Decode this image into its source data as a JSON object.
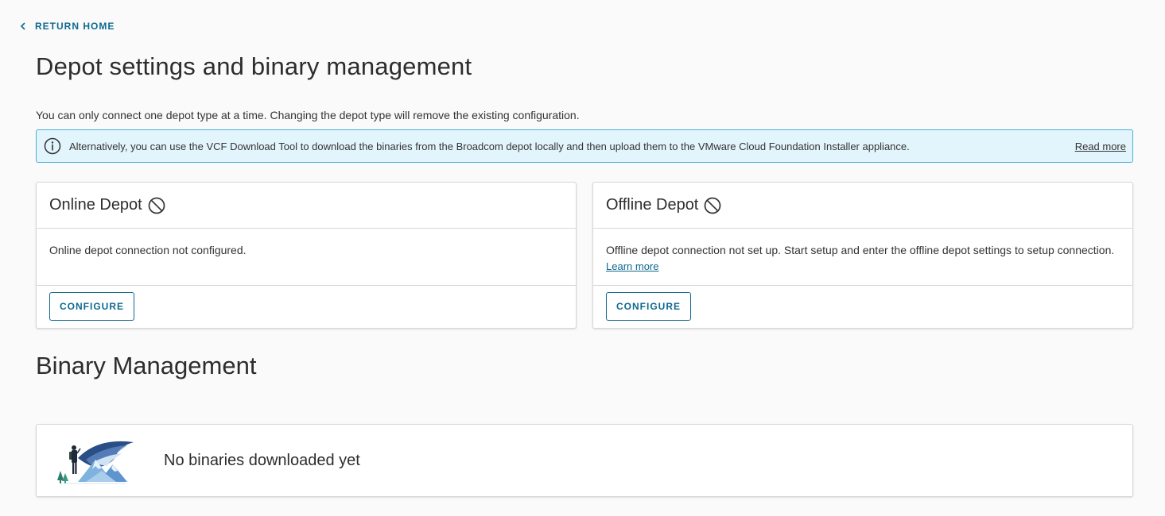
{
  "nav": {
    "return_home": "RETURN HOME"
  },
  "page": {
    "title": "Depot settings and binary management",
    "intro": "You can only connect one depot type at a time. Changing the depot type will remove the existing configuration."
  },
  "alert": {
    "icon": "info-icon",
    "text": "Alternatively, you can use the VCF Download Tool to download the binaries from the Broadcom depot locally and then upload them to the VMware Cloud Foundation Installer appliance.",
    "link": "Read more",
    "color": "#e3f5fc",
    "border": "#49afd9"
  },
  "online_depot": {
    "title": "Online Depot",
    "status_icon": "ban-icon",
    "message": "Online depot connection not configured.",
    "button": "CONFIGURE"
  },
  "offline_depot": {
    "title": "Offline Depot",
    "status_icon": "ban-icon",
    "message": "Offline depot connection not set up. Start setup and enter the offline depot settings to setup connection.",
    "link": "Learn more",
    "button": "CONFIGURE"
  },
  "binary_management": {
    "title": "Binary Management",
    "empty_message": "No binaries downloaded yet",
    "illustration": "hiker-mountains-illustration"
  },
  "colors": {
    "accent": "#0d6a8f",
    "text": "#333333"
  }
}
